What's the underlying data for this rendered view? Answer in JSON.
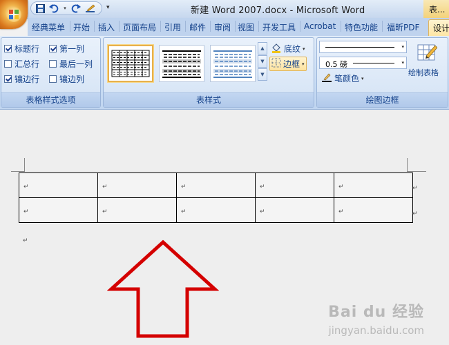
{
  "window": {
    "title": "新建 Word 2007.docx - Microsoft Word",
    "context_tab_label": "表...",
    "qat_more": "▾"
  },
  "tabs": [
    {
      "label": "经典菜单"
    },
    {
      "label": "开始"
    },
    {
      "label": "插入"
    },
    {
      "label": "页面布局"
    },
    {
      "label": "引用"
    },
    {
      "label": "邮件"
    },
    {
      "label": "审阅"
    },
    {
      "label": "视图"
    },
    {
      "label": "开发工具"
    },
    {
      "label": "Acrobat"
    },
    {
      "label": "特色功能"
    },
    {
      "label": "福昕PDF"
    }
  ],
  "active_tab": "设计",
  "table_style_options": {
    "group_label": "表格样式选项",
    "options": [
      {
        "label": "标题行",
        "checked": true
      },
      {
        "label": "第一列",
        "checked": true
      },
      {
        "label": "汇总行",
        "checked": false
      },
      {
        "label": "最后一列",
        "checked": false
      },
      {
        "label": "镶边行",
        "checked": true
      },
      {
        "label": "镶边列",
        "checked": false
      }
    ]
  },
  "table_styles": {
    "group_label": "表样式",
    "shading_label": "底纹",
    "borders_label": "边框"
  },
  "draw_borders": {
    "group_label": "绘图边框",
    "line_weight": "0.5 磅",
    "pen_color_label": "笔颜色",
    "draw_table_label": "绘制表格"
  },
  "document": {
    "paragraph_mark": "↵",
    "rows": 2,
    "cols": 5
  },
  "watermark": {
    "text": "Bai du 经验",
    "sub": "jingyan.baidu.com"
  },
  "colors": {
    "arrow": "#d40000",
    "ribbon_text": "#15428b",
    "selected_style_border": "#e7b04a"
  }
}
